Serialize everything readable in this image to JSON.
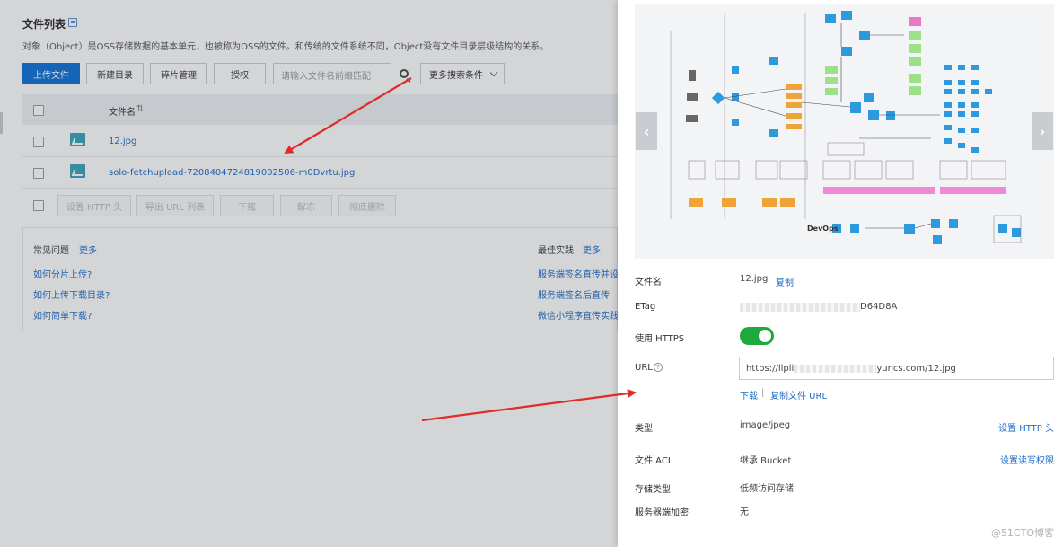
{
  "left": {
    "title": "文件列表",
    "description": "对象（Object）是OSS存储数据的基本单元，也被称为OSS的文件。和传统的文件系统不同，Object没有文件目录层级结构的关系。",
    "toolbar": {
      "upload": "上传文件",
      "new_dir": "新建目录",
      "fragments": "碎片管理",
      "authorize": "授权",
      "search_placeholder": "请输入文件名前缀匹配",
      "more_search": "更多搜索条件"
    },
    "table": {
      "col_name": "文件名",
      "sort_glyph": "⇅",
      "files": [
        "12.jpg",
        "solo-fetchupload-7208404724819002506-m0Dvrtu.jpg"
      ],
      "batch": [
        "设置 HTTP 头",
        "导出 URL 列表",
        "下载",
        "解冻",
        "彻底删除"
      ]
    },
    "faq": {
      "title": "常见问题",
      "more": "更多",
      "items": [
        "如何分片上传?",
        "如何上传下载目录?",
        "如何简单下载?"
      ]
    },
    "best": {
      "title": "最佳实践",
      "more": "更多",
      "items": [
        "服务端签名直传并设",
        "服务端签名后直传",
        "微信小程序直传实践"
      ]
    }
  },
  "panel": {
    "filename_label": "文件名",
    "filename": "12.jpg",
    "copy": "复制",
    "etag_label": "ETag",
    "etag_tail": "D64D8A",
    "https_label": "使用 HTTPS",
    "url_label": "URL",
    "url_prefix": "https://llpli",
    "url_suffix": "yuncs.com/12.jpg",
    "download": "下载",
    "sep": "|",
    "copy_url": "复制文件 URL",
    "type_label": "类型",
    "type": "image/jpeg",
    "set_http": "设置 HTTP 头",
    "acl_label": "文件 ACL",
    "acl": "继承 Bucket",
    "set_acl": "设置读写权限",
    "storage_label": "存储类型",
    "storage": "低频访问存储",
    "encrypt_label": "服务器端加密",
    "encrypt": "无",
    "preview_caption": "DevOps",
    "prev_glyph": "‹",
    "next_glyph": "›"
  },
  "watermark": "@51CTO博客",
  "colors": {
    "primary": "#0b6fd6",
    "link": "#1f6bc5",
    "toggle_on": "#1fa83b",
    "arrow": "#e02b27"
  }
}
